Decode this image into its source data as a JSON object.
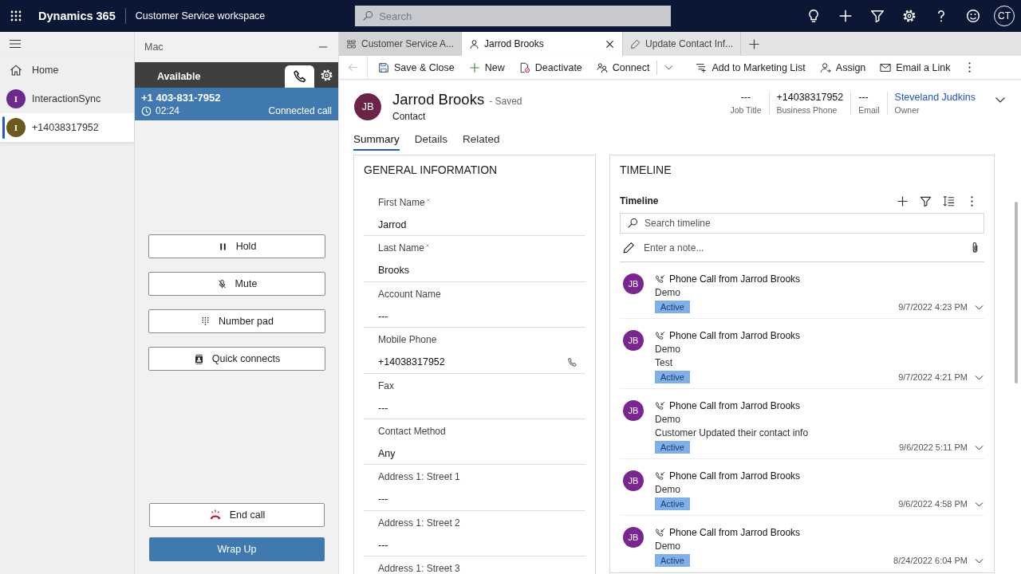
{
  "topbar": {
    "app": "Dynamics 365",
    "workspace": "Customer Service workspace",
    "search": {
      "placeholder": "Search"
    },
    "avatar": "CT"
  },
  "sidebar": {
    "items": [
      {
        "label": "Home",
        "kind": "nav",
        "selected": false
      },
      {
        "label": "InteractionSync",
        "kind": "session",
        "avatar": "I",
        "color": "#6b2a8c",
        "selected": false
      },
      {
        "label": "+14038317952",
        "kind": "session",
        "avatar": "I",
        "color": "#6b5a1e",
        "selected": true
      }
    ]
  },
  "cti": {
    "title": "Mac",
    "status": "Available",
    "call": {
      "number": "+1 403-831-7952",
      "timer": "02:24",
      "state": "Connected call"
    },
    "buttons": [
      {
        "label": "Hold",
        "kind": "hold"
      },
      {
        "label": "Mute",
        "kind": "mute"
      },
      {
        "label": "Number pad",
        "kind": "numpad"
      },
      {
        "label": "Quick connects",
        "kind": "quick"
      }
    ],
    "end_call": "End call",
    "wrap_up": "Wrap Up"
  },
  "tabs": [
    {
      "label": "Customer Service A...",
      "kind": "dashboard",
      "selected": false
    },
    {
      "label": "Jarrod Brooks",
      "kind": "contact",
      "selected": true
    },
    {
      "label": "Update Contact Inf...",
      "kind": "task",
      "selected": false
    }
  ],
  "commands": [
    {
      "label": "Save & Close",
      "kind": "button"
    },
    {
      "label": "New",
      "kind": "button"
    },
    {
      "label": "Deactivate",
      "kind": "button"
    },
    {
      "label": "Connect",
      "kind": "split"
    },
    {
      "label": "Add to Marketing List",
      "kind": "button"
    },
    {
      "label": "Assign",
      "kind": "button"
    },
    {
      "label": "Email a Link",
      "kind": "button"
    }
  ],
  "record": {
    "avatar": "JB",
    "name": "Jarrod Brooks",
    "status": "- Saved",
    "type": "Contact",
    "header_fields": [
      {
        "value": "---",
        "label": "Job Title",
        "kind": "text"
      },
      {
        "value": "+14038317952",
        "label": "Business Phone",
        "kind": "text"
      },
      {
        "value": "---",
        "label": "Email",
        "kind": "text"
      },
      {
        "value": "Steveland Judkins",
        "label": "Owner",
        "kind": "link"
      }
    ],
    "form_tabs": [
      {
        "label": "Summary",
        "selected": true
      },
      {
        "label": "Details",
        "selected": false
      },
      {
        "label": "Related",
        "selected": false
      }
    ]
  },
  "general": {
    "title": "GENERAL INFORMATION",
    "fields": [
      {
        "label": "First Name",
        "required": true,
        "value": "Jarrod",
        "kind": "text"
      },
      {
        "label": "Last Name",
        "required": true,
        "value": "Brooks",
        "kind": "text"
      },
      {
        "label": "Account Name",
        "required": false,
        "value": "---",
        "kind": "text"
      },
      {
        "label": "Mobile Phone",
        "required": false,
        "value": "+14038317952",
        "kind": "phone"
      },
      {
        "label": "Fax",
        "required": false,
        "value": "---",
        "kind": "text"
      },
      {
        "label": "Contact Method",
        "required": false,
        "value": "Any",
        "kind": "text"
      },
      {
        "label": "Address 1: Street 1",
        "required": false,
        "value": "---",
        "kind": "text"
      },
      {
        "label": "Address 1: Street 2",
        "required": false,
        "value": "---",
        "kind": "text"
      },
      {
        "label": "Address 1: Street 3",
        "required": false
      }
    ]
  },
  "timeline": {
    "title": "TIMELINE",
    "subtitle": "Timeline",
    "search": {
      "placeholder": "Search timeline"
    },
    "note": {
      "placeholder": "Enter a note..."
    },
    "items": [
      {
        "avatar": "JB",
        "title": "Phone Call from Jarrod Brooks",
        "lines": [
          "Demo"
        ],
        "status": "Active",
        "date": "9/7/2022 4:23 PM"
      },
      {
        "avatar": "JB",
        "title": "Phone Call from Jarrod Brooks",
        "lines": [
          "Demo",
          "Test"
        ],
        "status": "Active",
        "date": "9/7/2022 4:21 PM"
      },
      {
        "avatar": "JB",
        "title": "Phone Call from Jarrod Brooks",
        "lines": [
          "Demo",
          "Customer Updated their contact info"
        ],
        "status": "Active",
        "date": "9/6/2022 5:11 PM"
      },
      {
        "avatar": "JB",
        "title": "Phone Call from Jarrod Brooks",
        "lines": [
          "Demo"
        ],
        "status": "Active",
        "date": "9/6/2022 4:58 PM"
      },
      {
        "avatar": "JB",
        "title": "Phone Call from Jarrod Brooks",
        "lines": [
          "Demo"
        ],
        "status": "Active",
        "date": "8/24/2022 6:04 PM"
      }
    ]
  }
}
